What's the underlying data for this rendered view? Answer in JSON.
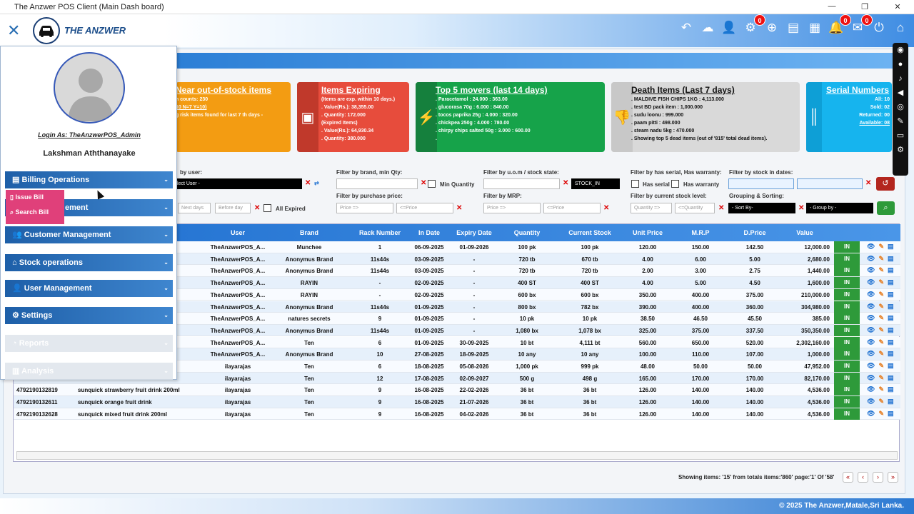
{
  "window": {
    "title": "The Anzwer POS Client (Main Dash board)",
    "controls": [
      "—",
      "❐",
      "✕"
    ]
  },
  "app": {
    "brand": "THE ANZWER",
    "close_glyph": "✕"
  },
  "topbar": {
    "icons": [
      {
        "name": "back-arrow-icon",
        "glyph": "↶"
      },
      {
        "name": "cloud-upload-icon",
        "glyph": "☁"
      },
      {
        "name": "add-user-icon",
        "glyph": "👤"
      },
      {
        "name": "gear-icon",
        "glyph": "⚙",
        "badge": "0"
      },
      {
        "name": "add-circle-icon",
        "glyph": "⊕"
      },
      {
        "name": "card-icon",
        "glyph": "▤"
      },
      {
        "name": "calculator-icon",
        "glyph": "▦"
      },
      {
        "name": "bell-icon",
        "glyph": "🔔",
        "badge": "0"
      },
      {
        "name": "mail-icon",
        "glyph": "✉",
        "badge": "0"
      },
      {
        "name": "power-icon",
        "glyph": "⏻"
      },
      {
        "name": "home-icon",
        "glyph": "⌂"
      }
    ]
  },
  "sidebar": {
    "login_as": "Login As: TheAnzwerPOS_Admin",
    "user_name": "Lakshman Aththanayake",
    "menu": {
      "billing": "Billing Operations",
      "hidden_partial": "ement",
      "customer": "Customer Management",
      "stock": "Stock operations",
      "user": "User Management",
      "settings": "Settings",
      "reports": "Reports",
      "analysis": "Analysis"
    },
    "submenu": {
      "issue": "Issue Bill",
      "search": "Search Bill"
    }
  },
  "cards": {
    "near": {
      "title": "Near out-of-stock items",
      "lines": [
        "n counts: 230",
        "10 N=7 Y=10)",
        "g risk items found for last 7 th days -"
      ]
    },
    "expiring": {
      "title": "Items Expiring",
      "lines": [
        "(Items are exp. within 10 days.)",
        ". Value(Rs.): 38,355.00",
        ". Quantity: 172.000",
        "(Expired Items)",
        ". Value(Rs.): 64,930.34",
        ". Quantity: 380.000"
      ]
    },
    "movers": {
      "title": "Top 5 movers (last 14 days)",
      "lines": [
        ". Paracetamol : 24.000 : 363.00",
        ". glucorasa 70g : 6.000 : 840.00",
        ". tocos paprika 25g : 4.000 : 320.00",
        ". chickpea 250g : 4.000 : 780.00",
        ". chirpy chips salted 50g : 3.000 : 600.00",
        "."
      ]
    },
    "death": {
      "title": "Death Items (Last 7 days)",
      "lines": [
        ". MALDIVE FISH CHIPS 1KG : 4,113.000",
        ". test BD pack item : 1,000.000",
        ". sudu loonu : 999.000",
        ". paam pitti : 498.000",
        ". steam nadu 5kg : 470.000",
        ". Showing top 5 dead items (out of '815' total dead items)."
      ]
    },
    "serial": {
      "title": "Serial Numbers",
      "lines": [
        "All: 10",
        "Sold: 02",
        "Returned: 00",
        "Available: 08"
      ]
    }
  },
  "filters": {
    "by_user": "by user:",
    "user_select": "lect User -",
    "brand_qty": "Filter by brand, min Qty:",
    "min_qty": "Min Quantity",
    "uom_state": "Filter by u.o.m / stock state:",
    "stock_in": "STOCK_IN",
    "serial_warranty": "Filter by has serial, Has warranty:",
    "has_serial": "Has serial",
    "has_warranty": "Has warranty",
    "stock_dates": "Filter by stock in dates:",
    "next_days": "Next days",
    "before_day": "Before day",
    "all_expired": "All Expired",
    "purchase_price": "Filter by purchase price:",
    "mrp": "Filter by MRP:",
    "current_level": "Filter by current stock level:",
    "grouping": "Grouping & Sorting:",
    "price_gt": "Price =>",
    "price_lt": "<=Price",
    "qty_gt": "Quantity =>",
    "qty_lt": "<=Quantity",
    "sort_by": "- Sort By-",
    "group_by": "- Group by -"
  },
  "table": {
    "headers": [
      "User",
      "Brand",
      "Rack Number",
      "In Date",
      "Expiry Date",
      "Quantity",
      "Current Stock",
      "Unit Price",
      "M.R.P",
      "D.Price",
      "Value"
    ],
    "rows": [
      {
        "code": "",
        "name": "",
        "user": "TheAnzwerPOS_A...",
        "brand": "Munchee",
        "rack": "1",
        "indate": "06-09-2025",
        "exp": "01-09-2026",
        "qty": "100 pk",
        "cur": "100 pk",
        "unit": "120.00",
        "mrp": "150.00",
        "dp": "142.50",
        "value": "12,000.00",
        "state": "IN"
      },
      {
        "code": "",
        "name": "",
        "user": "TheAnzwerPOS_A...",
        "brand": "Anonymus Brand",
        "rack": "11s44s",
        "indate": "03-09-2025",
        "exp": "-",
        "qty": "720 tb",
        "cur": "670 tb",
        "unit": "4.00",
        "mrp": "6.00",
        "dp": "5.00",
        "value": "2,680.00",
        "state": "IN"
      },
      {
        "code": "",
        "name": "",
        "user": "TheAnzwerPOS_A...",
        "brand": "Anonymus Brand",
        "rack": "11s44s",
        "indate": "03-09-2025",
        "exp": "-",
        "qty": "720 tb",
        "cur": "720 tb",
        "unit": "2.00",
        "mrp": "3.00",
        "dp": "2.75",
        "value": "1,440.00",
        "state": "IN"
      },
      {
        "code": "",
        "name": "",
        "user": "TheAnzwerPOS_A...",
        "brand": "RAYIN",
        "rack": "-",
        "indate": "02-09-2025",
        "exp": "-",
        "qty": "400 ST",
        "cur": "400 ST",
        "unit": "4.00",
        "mrp": "5.00",
        "dp": "4.50",
        "value": "1,600.00",
        "state": "IN"
      },
      {
        "code": "",
        "name": "",
        "user": "TheAnzwerPOS_A...",
        "brand": "RAYIN",
        "rack": "-",
        "indate": "02-09-2025",
        "exp": "-",
        "qty": "600 bx",
        "cur": "600 bx",
        "unit": "350.00",
        "mrp": "400.00",
        "dp": "375.00",
        "value": "210,000.00",
        "state": "IN"
      },
      {
        "code": "",
        "name": "",
        "user": "TheAnzwerPOS_A...",
        "brand": "Anonymus Brand",
        "rack": "11s44s",
        "indate": "01-09-2025",
        "exp": "-",
        "qty": "800 bx",
        "cur": "782 bx",
        "unit": "390.00",
        "mrp": "400.00",
        "dp": "360.00",
        "value": "304,980.00",
        "state": "IN"
      },
      {
        "code": "",
        "name": "",
        "user": "TheAnzwerPOS_A...",
        "brand": "natures secrets",
        "rack": "9",
        "indate": "01-09-2025",
        "exp": "-",
        "qty": "10 pk",
        "cur": "10 pk",
        "unit": "38.50",
        "mrp": "46.50",
        "dp": "45.50",
        "value": "385.00",
        "state": "IN"
      },
      {
        "code": "",
        "name": "",
        "user": "TheAnzwerPOS_A...",
        "brand": "Anonymus Brand",
        "rack": "11s44s",
        "indate": "01-09-2025",
        "exp": "-",
        "qty": "1,080 bx",
        "cur": "1,078 bx",
        "unit": "325.00",
        "mrp": "375.00",
        "dp": "337.50",
        "value": "350,350.00",
        "state": "IN"
      },
      {
        "code": "",
        "name": "",
        "user": "TheAnzwerPOS_A...",
        "brand": "Ten",
        "rack": "6",
        "indate": "01-09-2025",
        "exp": "30-09-2025",
        "qty": "10 bt",
        "cur": "4,111 bt",
        "unit": "560.00",
        "mrp": "650.00",
        "dp": "520.00",
        "value": "2,302,160.00",
        "state": "IN"
      },
      {
        "code": "",
        "name": "",
        "user": "TheAnzwerPOS_A...",
        "brand": "Anonymus Brand",
        "rack": "10",
        "indate": "27-08-2025",
        "exp": "18-09-2025",
        "qty": "10 any",
        "cur": "10 any",
        "unit": "100.00",
        "mrp": "110.00",
        "dp": "107.00",
        "value": "1,000.00",
        "state": "IN"
      },
      {
        "code": "",
        "name": "",
        "user": "ilayarajas",
        "brand": "Ten",
        "rack": "6",
        "indate": "18-08-2025",
        "exp": "05-08-2026",
        "qty": "1,000 pk",
        "cur": "999 pk",
        "unit": "48.00",
        "mrp": "50.00",
        "dp": "50.00",
        "value": "47,952.00",
        "state": "IN"
      },
      {
        "code": "",
        "name": "",
        "user": "ilayarajas",
        "brand": "Ten",
        "rack": "12",
        "indate": "17-08-2025",
        "exp": "02-09-2027",
        "qty": "500 g",
        "cur": "498 g",
        "unit": "165.00",
        "mrp": "170.00",
        "dp": "170.00",
        "value": "82,170.00",
        "state": "IN"
      },
      {
        "code": "4792190132819",
        "name": "sunquick strawberry fruit drink 200ml",
        "user": "ilayarajas",
        "brand": "Ten",
        "rack": "9",
        "indate": "16-08-2025",
        "exp": "22-02-2026",
        "qty": "36 bt",
        "cur": "36 bt",
        "unit": "126.00",
        "mrp": "140.00",
        "dp": "140.00",
        "value": "4,536.00",
        "state": "IN"
      },
      {
        "code": "4792190132611",
        "name": "sunquick orange fruit drink",
        "user": "ilayarajas",
        "brand": "Ten",
        "rack": "9",
        "indate": "16-08-2025",
        "exp": "21-07-2026",
        "qty": "36 bt",
        "cur": "36 bt",
        "unit": "126.00",
        "mrp": "140.00",
        "dp": "140.00",
        "value": "4,536.00",
        "state": "IN"
      },
      {
        "code": "4792190132628",
        "name": "sunquick mixed fruit drink 200ml",
        "user": "ilayarajas",
        "brand": "Ten",
        "rack": "9",
        "indate": "16-08-2025",
        "exp": "04-02-2026",
        "qty": "36 bt",
        "cur": "36 bt",
        "unit": "126.00",
        "mrp": "140.00",
        "dp": "140.00",
        "value": "4,536.00",
        "state": "IN"
      }
    ]
  },
  "paging": {
    "text": "Showing items: '15' from totals items:'860' page:'1' Of '58'"
  },
  "footer": {
    "text": "© 2025 The Anzwer,Matale,Sri Lanka."
  },
  "colors": {
    "near": "#f39c12",
    "expiring": "#e74c3c",
    "movers": "#16a34a",
    "death": "#d9d9d9",
    "serial": "#16b4ee"
  }
}
